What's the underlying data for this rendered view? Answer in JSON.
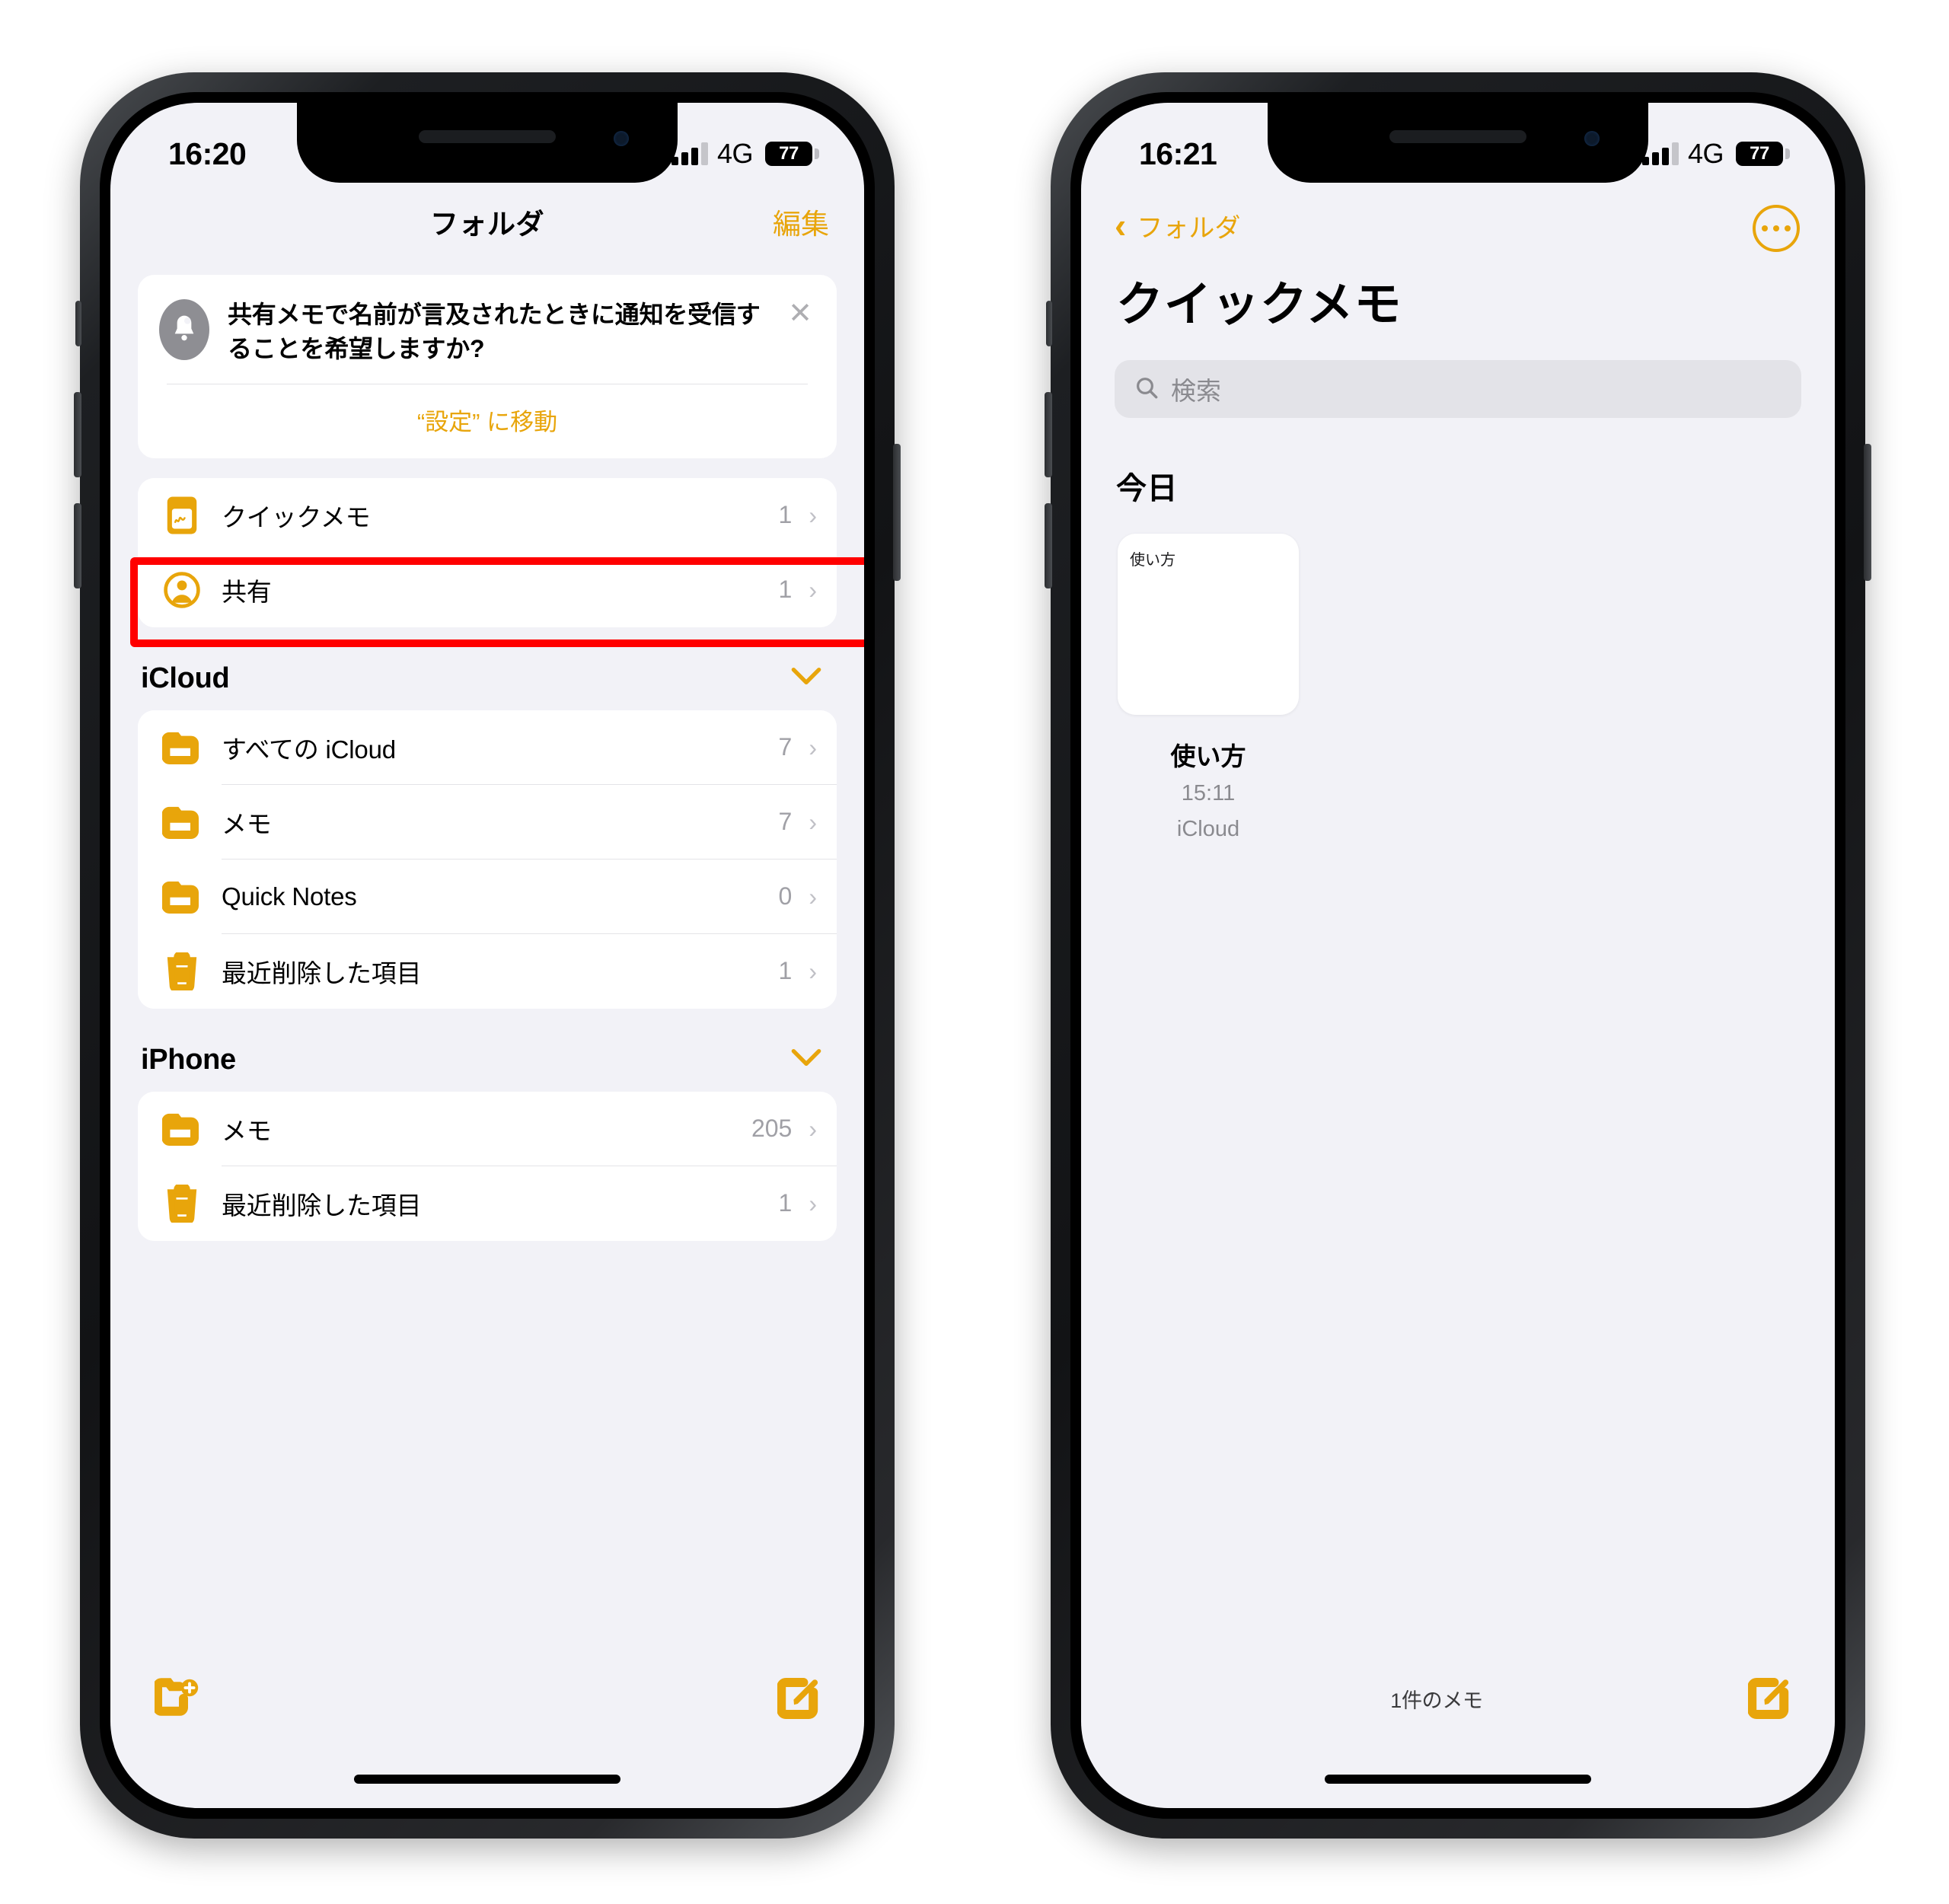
{
  "accent_color": "#E8A50B",
  "highlight_color": "#FF0000",
  "phones": {
    "left": {
      "status_bar": {
        "time": "16:20",
        "network": "4G",
        "battery": "77",
        "signal_icon": "cellular-bars-icon",
        "battery_icon": "battery-icon"
      },
      "nav": {
        "title": "フォルダ",
        "edit_label": "編集"
      },
      "banner": {
        "icon": "bell-notification-icon",
        "message": "共有メモで名前が言及されたときに通知を受信することを希望しますか?",
        "action_label": "“設定” に移動",
        "close_icon": "close-icon"
      },
      "pinned_group": [
        {
          "icon": "quick-note-icon",
          "label": "クイックメモ",
          "count": "1",
          "chevron": "chevron-right-icon",
          "highlighted": true
        },
        {
          "icon": "shared-person-icon",
          "label": "共有",
          "count": "1",
          "chevron": "chevron-right-icon",
          "highlighted": false
        }
      ],
      "sections": [
        {
          "title": "iCloud",
          "collapse_icon": "chevron-down-icon",
          "rows": [
            {
              "icon": "folder-icon",
              "label": "すべての iCloud",
              "count": "7",
              "chevron": "chevron-right-icon"
            },
            {
              "icon": "folder-icon",
              "label": "メモ",
              "count": "7",
              "chevron": "chevron-right-icon"
            },
            {
              "icon": "folder-icon",
              "label": "Quick Notes",
              "count": "0",
              "chevron": "chevron-right-icon"
            },
            {
              "icon": "trash-icon",
              "label": "最近削除した項目",
              "count": "1",
              "chevron": "chevron-right-icon"
            }
          ]
        },
        {
          "title": "iPhone",
          "collapse_icon": "chevron-down-icon",
          "rows": [
            {
              "icon": "folder-icon",
              "label": "メモ",
              "count": "205",
              "chevron": "chevron-right-icon"
            },
            {
              "icon": "trash-icon",
              "label": "最近削除した項目",
              "count": "1",
              "chevron": "chevron-right-icon"
            }
          ]
        }
      ],
      "toolbar": {
        "new_folder_icon": "new-folder-icon",
        "compose_icon": "compose-note-icon"
      }
    },
    "right": {
      "status_bar": {
        "time": "16:21",
        "network": "4G",
        "battery": "77",
        "signal_icon": "cellular-bars-icon",
        "battery_icon": "battery-icon"
      },
      "nav": {
        "back_label": "フォルダ",
        "back_icon": "chevron-left-icon",
        "more_icon": "more-ellipsis-icon"
      },
      "title": "クイックメモ",
      "search": {
        "placeholder": "検索",
        "icon": "search-icon",
        "value": ""
      },
      "section_header": "今日",
      "notes": [
        {
          "snippet": "使い方",
          "title": "使い方",
          "time": "15:11",
          "account": "iCloud"
        }
      ],
      "toolbar": {
        "count_label": "1件のメモ",
        "compose_icon": "compose-note-icon"
      }
    }
  }
}
